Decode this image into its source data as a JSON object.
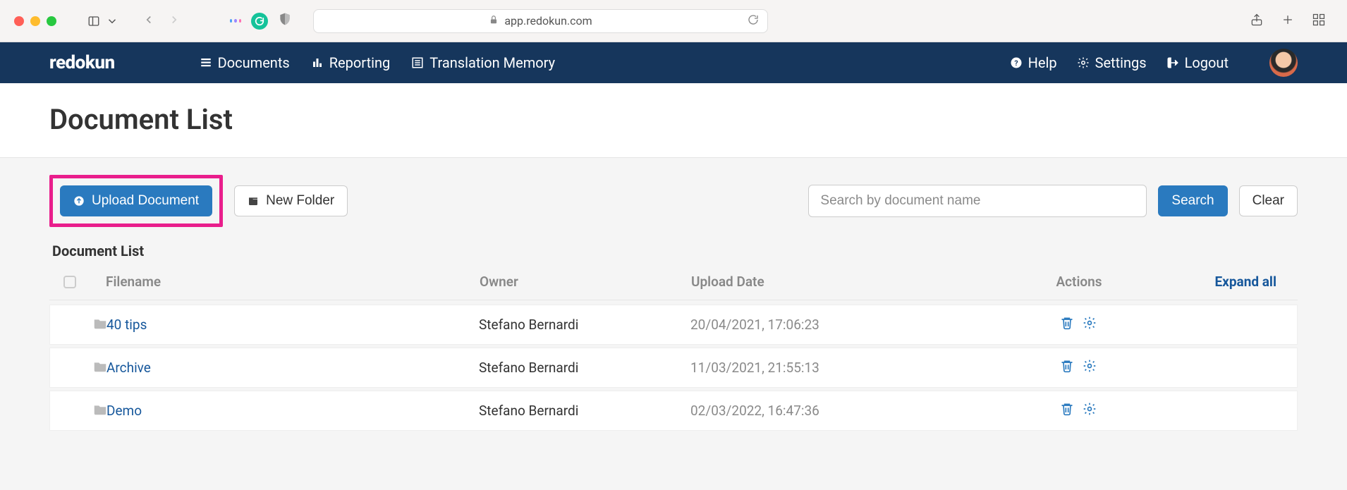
{
  "browser": {
    "url": "app.redokun.com"
  },
  "navbar": {
    "brand": "redokun",
    "items": [
      {
        "label": "Documents"
      },
      {
        "label": "Reporting"
      },
      {
        "label": "Translation Memory"
      }
    ],
    "right": [
      {
        "label": "Help"
      },
      {
        "label": "Settings"
      },
      {
        "label": "Logout"
      }
    ]
  },
  "page": {
    "title": "Document List"
  },
  "toolbar": {
    "upload_label": "Upload Document",
    "new_folder_label": "New Folder",
    "search_placeholder": "Search by document name",
    "search_button": "Search",
    "clear_button": "Clear"
  },
  "doclist": {
    "section_title": "Document List",
    "columns": {
      "filename": "Filename",
      "owner": "Owner",
      "upload_date": "Upload Date",
      "actions": "Actions",
      "expand_all": "Expand all"
    },
    "rows": [
      {
        "filename": "40 tips",
        "owner": "Stefano Bernardi",
        "upload_date": "20/04/2021, 17:06:23"
      },
      {
        "filename": "Archive",
        "owner": "Stefano Bernardi",
        "upload_date": "11/03/2021, 21:55:13"
      },
      {
        "filename": "Demo",
        "owner": "Stefano Bernardi",
        "upload_date": "02/03/2022, 16:47:36"
      }
    ]
  }
}
